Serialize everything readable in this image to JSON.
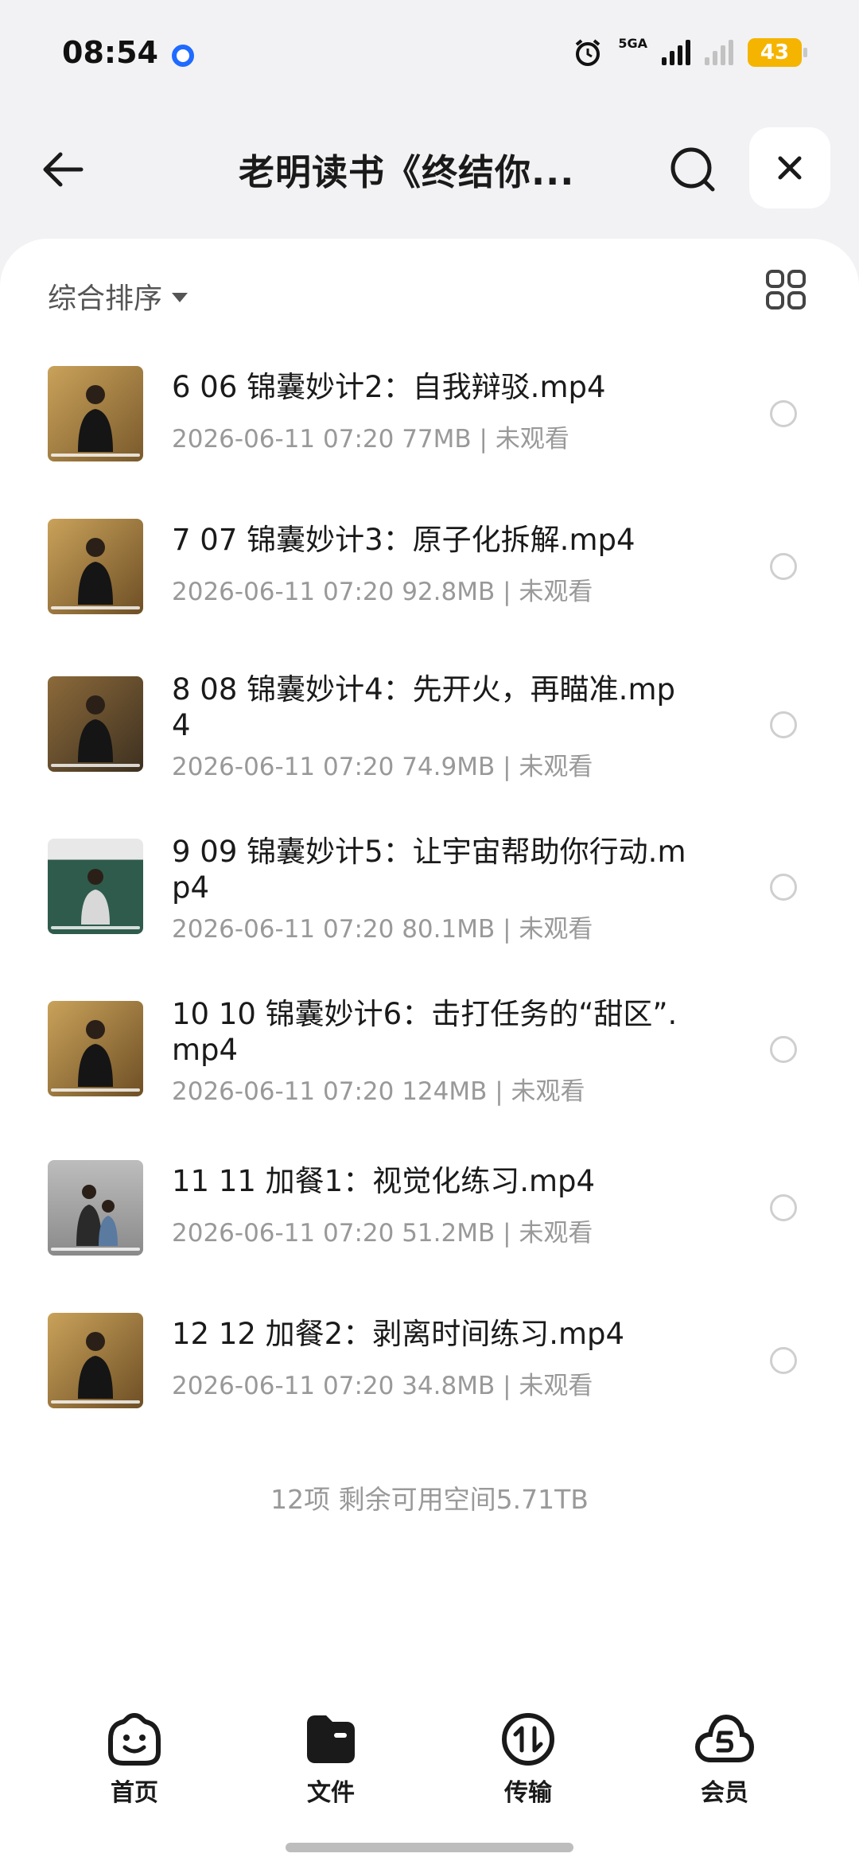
{
  "status": {
    "time": "08:54",
    "network": "5GA",
    "battery": "43"
  },
  "header": {
    "title": "老明读书《终结你..."
  },
  "toolbar": {
    "sort_label": "综合排序"
  },
  "files": [
    {
      "name": "6 06 锦囊妙计2：自我辩驳.mp4",
      "meta": "2026-06-11 07:20  77MB | 未观看"
    },
    {
      "name": "7 07 锦囊妙计3：原子化拆解.mp4",
      "meta": "2026-06-11 07:20  92.8MB | 未观看"
    },
    {
      "name": "8 08 锦囊妙计4：先开火，再瞄准.mp4",
      "meta": "2026-06-11 07:20  74.9MB | 未观看"
    },
    {
      "name": "9 09 锦囊妙计5：让宇宙帮助你行动.mp4",
      "meta": "2026-06-11 07:20  80.1MB | 未观看"
    },
    {
      "name": "10 10 锦囊妙计6：击打任务的“甜区”.mp4",
      "meta": "2026-06-11 07:20  124MB | 未观看"
    },
    {
      "name": "11 11 加餐1：视觉化练习.mp4",
      "meta": "2026-06-11 07:20  51.2MB | 未观看"
    },
    {
      "name": "12 12 加餐2：剥离时间练习.mp4",
      "meta": "2026-06-11 07:20  34.8MB | 未观看"
    }
  ],
  "summary": "12项 剩余可用空间5.71TB",
  "tabs": [
    {
      "label": "首页"
    },
    {
      "label": "文件"
    },
    {
      "label": "传输"
    },
    {
      "label": "会员"
    }
  ],
  "colors": {
    "accent": "#1f6bff",
    "battery": "#f5b400",
    "panel": "#ffffff",
    "background": "#f2f2f4"
  }
}
